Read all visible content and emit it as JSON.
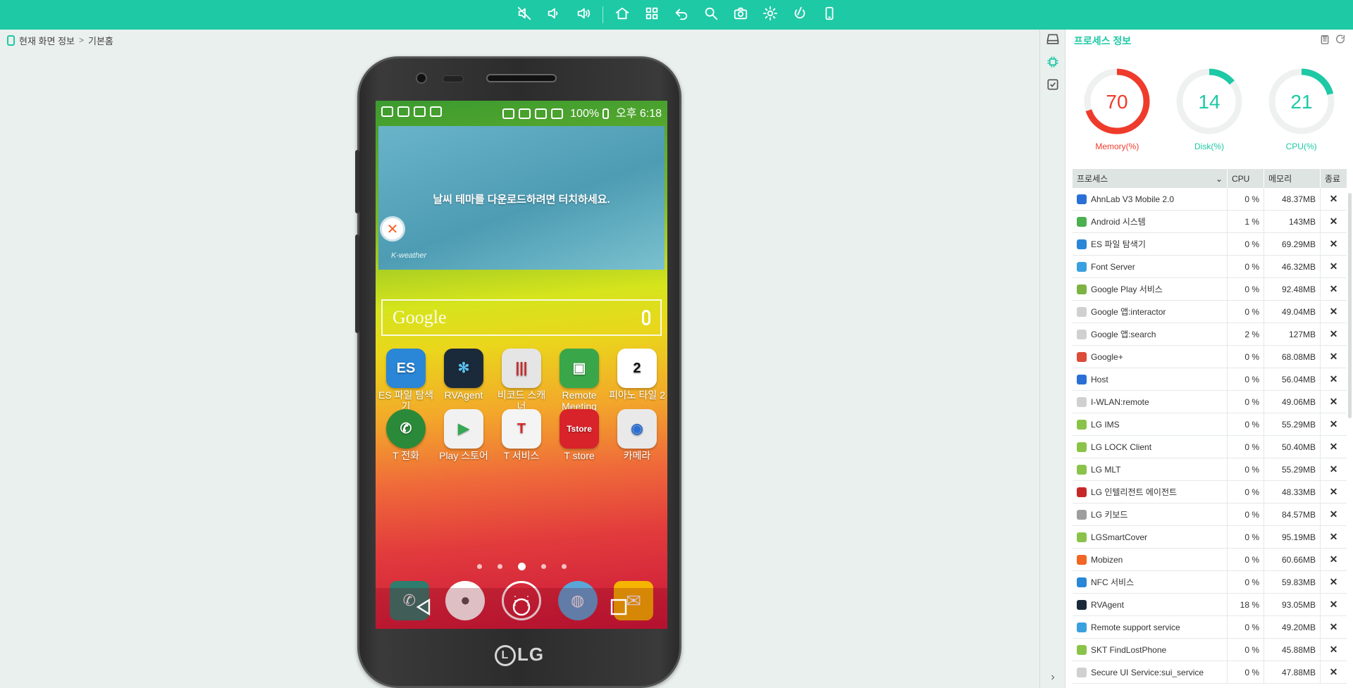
{
  "toolbar": {
    "buttons": [
      {
        "name": "mute-icon"
      },
      {
        "name": "volume-down-icon"
      },
      {
        "name": "volume-up-icon"
      },
      {
        "name": "home-icon"
      },
      {
        "name": "apps-icon"
      },
      {
        "name": "back-icon"
      },
      {
        "name": "search-icon"
      },
      {
        "name": "screenshot-icon"
      },
      {
        "name": "settings-icon"
      },
      {
        "name": "power-icon"
      },
      {
        "name": "rotate-icon"
      }
    ]
  },
  "breadcrumb": {
    "root": "현재 화면 정보",
    "current": "기본홈"
  },
  "phone": {
    "status": {
      "battery": "100%",
      "time": "오후 6:18"
    },
    "weather_message": "날씨 테마를 다운로드하려면 터치하세요.",
    "weather_brand": "K-weather",
    "search_logo": "Google",
    "apps_row1": [
      {
        "label": "ES 파일 탐색기",
        "color": "#2a86d6"
      },
      {
        "label": "RVAgent",
        "color": "#1b2a3a"
      },
      {
        "label": "비코드 스캐너",
        "color": "#cfcfcf"
      },
      {
        "label": "Remote Meeting",
        "color": "#3aa64a"
      },
      {
        "label": "피아노 타일 2",
        "color": "#ffffff"
      }
    ],
    "apps_row2": [
      {
        "label": "T 전화",
        "color": "#2a8a3a"
      },
      {
        "label": "Play 스토어",
        "color": "#f1f1f1"
      },
      {
        "label": "T 서비스",
        "color": "#f4f4f4"
      },
      {
        "label": "T store",
        "color": "#d8232a"
      },
      {
        "label": "카메라",
        "color": "#e9e9e9"
      }
    ],
    "brand": "LG"
  },
  "panel": {
    "title": "프로세스 정보",
    "gauges": [
      {
        "value": 70,
        "label": "Memory(%)",
        "color": "#ef3b2c"
      },
      {
        "value": 14,
        "label": "Disk(%)",
        "color": "#1ec9a5"
      },
      {
        "value": 21,
        "label": "CPU(%)",
        "color": "#1ec9a5"
      }
    ],
    "columns": {
      "name": "프로세스",
      "cpu": "CPU",
      "mem": "메모리",
      "kill": "종료"
    },
    "processes": [
      {
        "name": "AhnLab V3 Mobile 2.0",
        "cpu": "0 %",
        "mem": "48.37MB",
        "icon": "#2a6fd6"
      },
      {
        "name": "Android 시스템",
        "cpu": "1 %",
        "mem": "143MB",
        "icon": "#4caf50"
      },
      {
        "name": "ES 파일 탐색기",
        "cpu": "0 %",
        "mem": "69.29MB",
        "icon": "#2a86d6"
      },
      {
        "name": "Font Server",
        "cpu": "0 %",
        "mem": "46.32MB",
        "icon": "#3aa0e0"
      },
      {
        "name": "Google  Play 서비스",
        "cpu": "0 %",
        "mem": "92.48MB",
        "icon": "#7cb342"
      },
      {
        "name": "Google 앱:interactor",
        "cpu": "0 %",
        "mem": "49.04MB",
        "icon": "#d0d0d0"
      },
      {
        "name": "Google 앱:search",
        "cpu": "2 %",
        "mem": "127MB",
        "icon": "#d0d0d0"
      },
      {
        "name": "Google+",
        "cpu": "0 %",
        "mem": "68.08MB",
        "icon": "#dd4b39"
      },
      {
        "name": "Host",
        "cpu": "0 %",
        "mem": "56.04MB",
        "icon": "#2a6fd6"
      },
      {
        "name": "I-WLAN:remote",
        "cpu": "0 %",
        "mem": "49.06MB",
        "icon": "#d0d0d0"
      },
      {
        "name": "LG IMS",
        "cpu": "0 %",
        "mem": "55.29MB",
        "icon": "#8bc34a"
      },
      {
        "name": "LG LOCK Client",
        "cpu": "0 %",
        "mem": "50.40MB",
        "icon": "#8bc34a"
      },
      {
        "name": "LG MLT",
        "cpu": "0 %",
        "mem": "55.29MB",
        "icon": "#8bc34a"
      },
      {
        "name": "LG 인텔리전트 에이전트",
        "cpu": "0 %",
        "mem": "48.33MB",
        "icon": "#c62828"
      },
      {
        "name": "LG 키보드",
        "cpu": "0 %",
        "mem": "84.57MB",
        "icon": "#9e9e9e"
      },
      {
        "name": "LGSmartCover",
        "cpu": "0 %",
        "mem": "95.19MB",
        "icon": "#8bc34a"
      },
      {
        "name": "Mobizen",
        "cpu": "0 %",
        "mem": "60.66MB",
        "icon": "#f26522"
      },
      {
        "name": "NFC 서비스",
        "cpu": "0 %",
        "mem": "59.83MB",
        "icon": "#2a86d6"
      },
      {
        "name": "RVAgent",
        "cpu": "18 %",
        "mem": "93.05MB",
        "icon": "#1b2a3a"
      },
      {
        "name": "Remote support service",
        "cpu": "0 %",
        "mem": "49.20MB",
        "icon": "#3aa0e0"
      },
      {
        "name": "SKT FindLostPhone",
        "cpu": "0 %",
        "mem": "45.88MB",
        "icon": "#8bc34a"
      },
      {
        "name": "Secure UI Service:sui_service",
        "cpu": "0 %",
        "mem": "47.88MB",
        "icon": "#d0d0d0"
      }
    ]
  }
}
